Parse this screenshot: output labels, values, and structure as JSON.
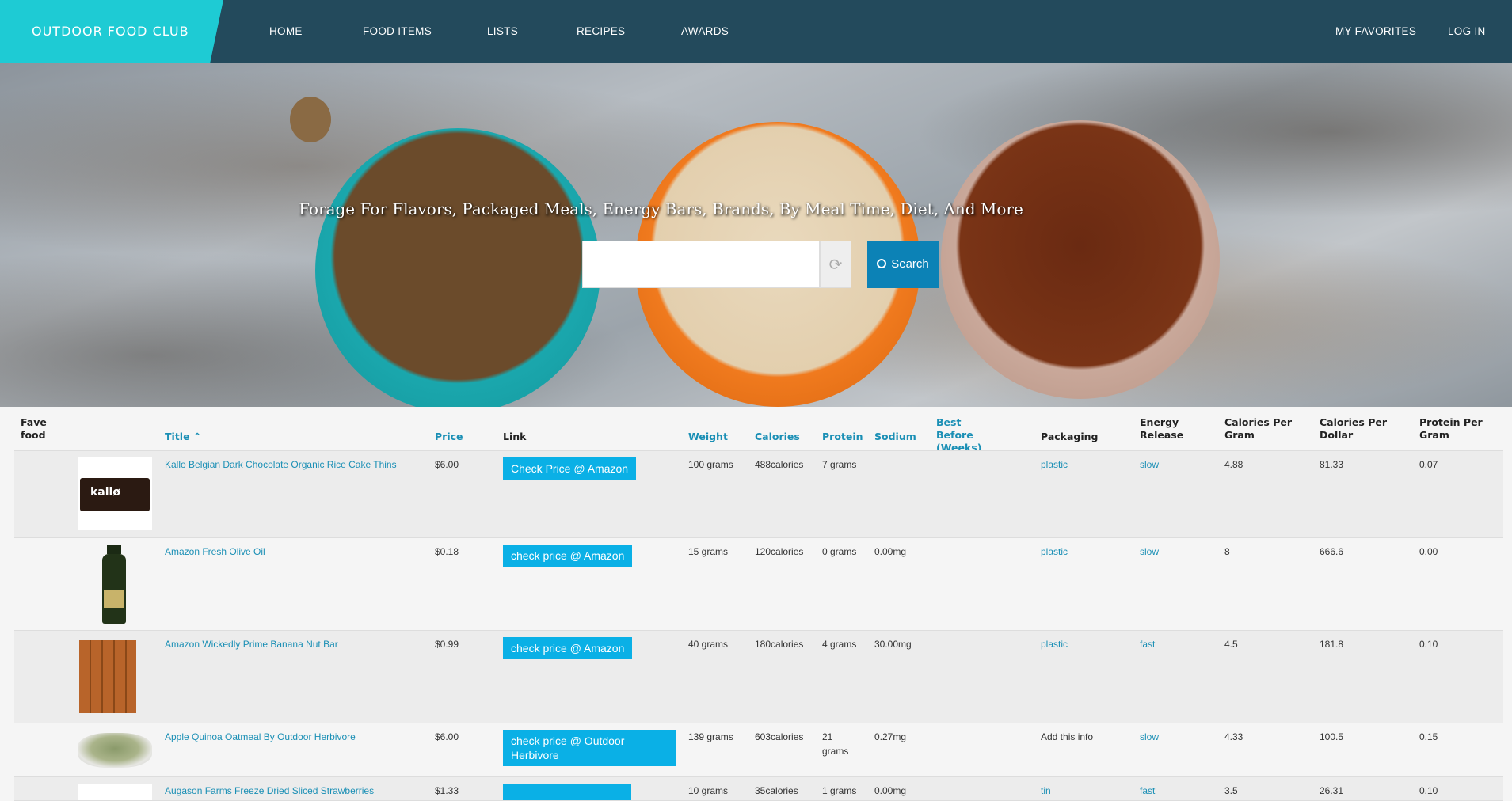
{
  "nav": {
    "brand": "OUTDOOR FOOD CLUB",
    "links": [
      "HOME",
      "FOOD ITEMS",
      "LISTS",
      "RECIPES",
      "AWARDS"
    ],
    "right": [
      "MY FAVORITES",
      "LOG IN"
    ]
  },
  "hero": {
    "tagline": "Forage For Flavors, Packaged Meals, Energy Bars, Brands, By Meal Time, Diet, And More",
    "search_value": "",
    "search_label": "Search"
  },
  "table": {
    "headers": {
      "fave": "Fave food",
      "title": "Title",
      "price": "Price",
      "link": "Link",
      "weight": "Weight",
      "calories": "Calories",
      "protein": "Protein",
      "sodium": "Sodium",
      "best_before": "Best Before (Weeks)",
      "packaging": "Packaging",
      "energy": "Energy Release",
      "cal_gram": "Calories Per Gram",
      "cal_dollar": "Calories Per Dollar",
      "protein_gram": "Protein Per Gram"
    },
    "rows": [
      {
        "title": "Kallo Belgian Dark Chocolate Organic Rice Cake Thins",
        "price": "$6.00",
        "link": "Check Price @ Amazon",
        "weight": "100 grams",
        "calories": "488calories",
        "protein": "7 grams",
        "sodium": "",
        "best_before": "",
        "packaging": "plastic",
        "energy": "slow",
        "cal_gram": "4.88",
        "cal_dollar": "81.33",
        "protein_gram": "0.07"
      },
      {
        "title": "Amazon Fresh Olive Oil",
        "price": "$0.18",
        "link": "check price @ Amazon",
        "weight": "15 grams",
        "calories": "120calories",
        "protein": "0 grams",
        "sodium": "0.00mg",
        "best_before": "",
        "packaging": "plastic",
        "energy": "slow",
        "cal_gram": "8",
        "cal_dollar": "666.6",
        "protein_gram": "0.00"
      },
      {
        "title": "Amazon Wickedly Prime Banana Nut Bar",
        "price": "$0.99",
        "link": "check price @ Amazon",
        "weight": "40 grams",
        "calories": "180calories",
        "protein": "4 grams",
        "sodium": "30.00mg",
        "best_before": "",
        "packaging": "plastic",
        "energy": "fast",
        "cal_gram": "4.5",
        "cal_dollar": "181.8",
        "protein_gram": "0.10"
      },
      {
        "title": "Apple Quinoa Oatmeal By Outdoor Herbivore",
        "price": "$6.00",
        "link": "check price @ Outdoor Herbivore",
        "weight": "139 grams",
        "calories": "603calories",
        "protein": "21 grams",
        "sodium": "0.27mg",
        "best_before": "",
        "packaging": "Add this info",
        "energy": "slow",
        "cal_gram": "4.33",
        "cal_dollar": "100.5",
        "protein_gram": "0.15"
      },
      {
        "title": "Augason Farms Freeze Dried Sliced Strawberries",
        "price": "$1.33",
        "link": "",
        "weight": "10 grams",
        "calories": "35calories",
        "protein": "1 grams",
        "sodium": "0.00mg",
        "best_before": "",
        "packaging": "tin",
        "energy": "fast",
        "cal_gram": "3.5",
        "cal_dollar": "26.31",
        "protein_gram": "0.10"
      }
    ]
  }
}
